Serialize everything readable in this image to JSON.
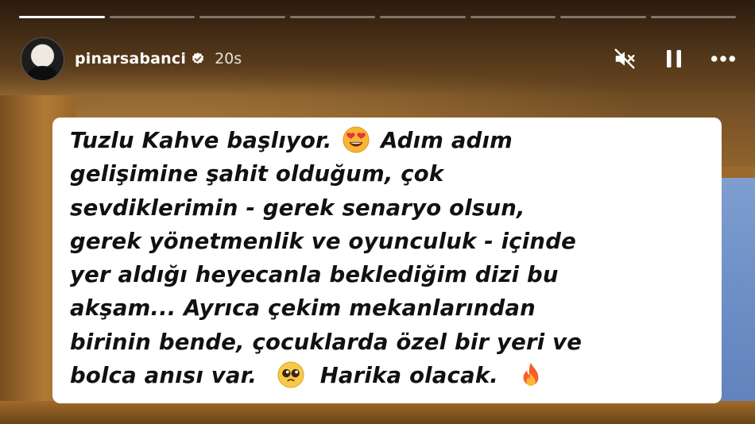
{
  "story": {
    "progress": {
      "segments": 8,
      "active_index": 0,
      "active_fraction": 1.0
    },
    "header": {
      "username": "pinarsabanci",
      "verified": true,
      "timestamp": "20s",
      "controls": [
        {
          "name": "mute",
          "icon": "speaker-muted-icon"
        },
        {
          "name": "pause",
          "icon": "pause-icon"
        },
        {
          "name": "more",
          "icon": "more-options-icon"
        }
      ]
    },
    "text_card": {
      "lines": [
        "Tuzlu Kahve başlıyor.",
        "Adım adım",
        "gelişimine şahit olduğum, çok",
        "sevdiklerimin - gerek senaryo olsun,",
        "gerek yönetmenlik ve oyunculuk - içinde",
        "yer aldığı heyecanla beklediğim dizi bu",
        "akşam... Ayrıca çekim mekanlarından",
        "birinin bende, çocuklarda özel bir yeri ve",
        "bolca anısı var.",
        "Harika olacak."
      ],
      "emojis": [
        "heart-eyes-emoji",
        "pleading-face-emoji",
        "fire-emoji"
      ]
    },
    "colors": {
      "card_background": "#ffffff",
      "text": "#111111",
      "ui_foreground": "#ffffff"
    }
  }
}
